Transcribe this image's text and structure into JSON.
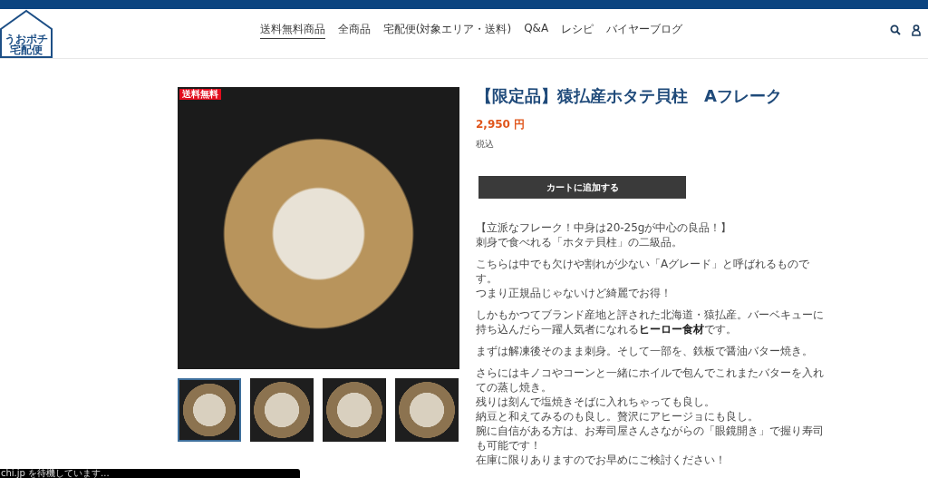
{
  "header": {
    "logo": {
      "line1": "うおポチ",
      "line2": "宅配便"
    },
    "nav": [
      {
        "label": "送料無料商品",
        "selected": true
      },
      {
        "label": "全商品",
        "selected": false
      },
      {
        "label": "宅配便(対象エリア・送料)",
        "selected": false
      },
      {
        "label": "Q&A",
        "selected": false
      },
      {
        "label": "レシピ",
        "selected": false
      },
      {
        "label": "バイヤーブログ",
        "selected": false
      }
    ]
  },
  "gallery": {
    "badge": "送料無料",
    "thumbnails": [
      {
        "selected": true
      },
      {
        "selected": false
      },
      {
        "selected": false
      },
      {
        "selected": false
      }
    ]
  },
  "product": {
    "title": "【限定品】猿払産ホタテ貝柱　Aフレーク",
    "price": "2,950 円",
    "tax_note": "税込",
    "add_to_cart": "カートに追加する",
    "description": [
      [
        "【立派なフレーク！中身は20-25gが中心の良品！】",
        "刺身で食べれる「ホタテ貝柱」の二級品。"
      ],
      [
        "こちらは中でも欠けや割れが少ない「Aグレード」と呼ばれるものです。",
        "つまり正規品じゃないけど綺麗でお得！"
      ],
      [
        "しかもかつてブランド産地と評された北海道・猿払産。バーベキューに持ち込んだら一躍人気者になれる**ヒーロー食材**です。"
      ],
      [
        "まずは解凍後そのまま刺身。そして一部を、鉄板で醤油バター焼き。"
      ],
      [
        "さらにはキノコやコーンと一緒にホイルで包んでこれまたバターを入れての蒸し焼き。",
        "残りは刻んで塩焼きそばに入れちゃっても良し。",
        "納豆と和えてみるのも良し。贅沢にアヒージョにも良し。",
        "腕に自信がある方は、お寿司屋さんさながらの「眼鏡開き」で握り寿司も可能です！",
        "在庫に限りありますのでお早めにご検討ください！"
      ]
    ]
  },
  "status_bar": {
    "text": "chi.jp を待機しています..."
  }
}
